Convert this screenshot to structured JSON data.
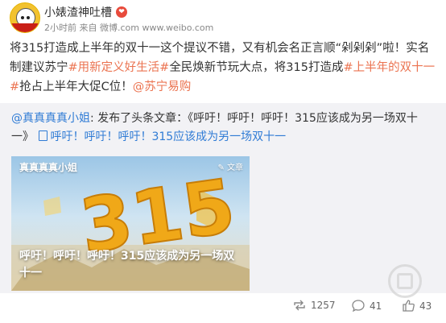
{
  "post": {
    "username": "小婊渣神吐槽",
    "time": "2小时前",
    "source": "来自 微博.com",
    "source_url": "www.weibo.com",
    "text": {
      "part1": "将315打造成上半年的双十一这个提议不错，又有机会名正言顺“剁剁剁”啦！实名制建议苏宁",
      "topic1": "#用新定义好生活#",
      "part2": "全民焕新节玩大点，将315打造成",
      "topic2": "#上半年的双十一#",
      "part3": "抢占上半年大促C位！",
      "mention": "@苏宁易购"
    }
  },
  "repost": {
    "author": "@真真真真小姐",
    "action": ": 发布了头条文章：《呼吁！呼吁！呼吁！315应该成为另一场双十一》",
    "article_link": "呼吁！呼吁！呼吁！315应该成为另一场双十一",
    "card": {
      "author": "真真真真小姐",
      "tag": "文章",
      "big_text": "315",
      "title": "呼吁！呼吁！呼吁！315应该成为另一场双十一"
    }
  },
  "actions": {
    "repost_count": "1257",
    "comment_count": "41",
    "like_count": "43"
  },
  "colors": {
    "link_orange": "#eb7350",
    "link_blue": "#2f7bd5",
    "repost_bg": "#f2f2f5"
  }
}
